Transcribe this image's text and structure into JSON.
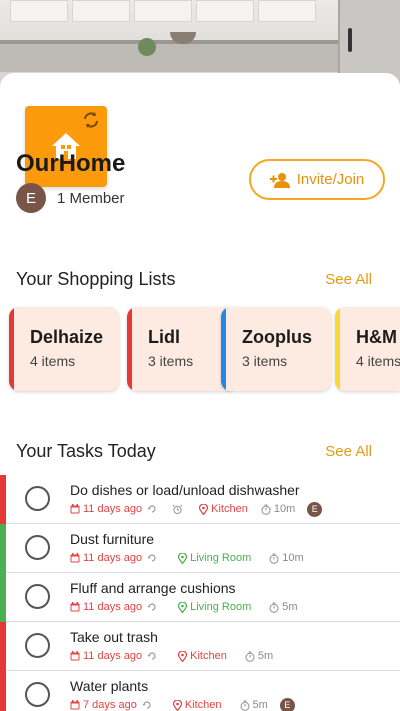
{
  "home": {
    "name": "OurHome",
    "member_initial": "E",
    "member_count_text": "1 Member",
    "invite_label": "Invite/Join",
    "accent_color": "#fb9a0b"
  },
  "shopping": {
    "title": "Your Shopping Lists",
    "see_all": "See All",
    "lists": [
      {
        "name": "Delhaize",
        "count": "4 items",
        "color": "#e53935"
      },
      {
        "name": "Lidl",
        "count": "3 items",
        "color": "#e53935"
      },
      {
        "name": "Zooplus",
        "count": "3 items",
        "color": "#1e88e5"
      },
      {
        "name": "H&M",
        "count": "4 items",
        "color": "#fdd835"
      }
    ]
  },
  "tasks": {
    "title": "Your Tasks Today",
    "see_all": "See All",
    "items": [
      {
        "title": "Do dishes or load/unload dishwasher",
        "ago": "11 days ago",
        "room": "Kitchen",
        "room_color": "red",
        "duration": "10m",
        "assignee": "E",
        "bar_color": "#e53935"
      },
      {
        "title": "Dust furniture",
        "ago": "11 days ago",
        "room": "Living Room",
        "room_color": "green",
        "duration": "10m",
        "assignee": "",
        "bar_color": "#4caf50"
      },
      {
        "title": "Fluff and arrange cushions",
        "ago": "11 days ago",
        "room": "Living Room",
        "room_color": "green",
        "duration": "5m",
        "assignee": "",
        "bar_color": "#4caf50"
      },
      {
        "title": "Take out trash",
        "ago": "11 days ago",
        "room": "Kitchen",
        "room_color": "red",
        "duration": "5m",
        "assignee": "",
        "bar_color": "#e53935"
      },
      {
        "title": "Water plants",
        "ago": "7 days ago",
        "room": "Kitchen",
        "room_color": "red",
        "duration": "5m",
        "assignee": "E",
        "bar_color": "#e53935"
      }
    ]
  }
}
